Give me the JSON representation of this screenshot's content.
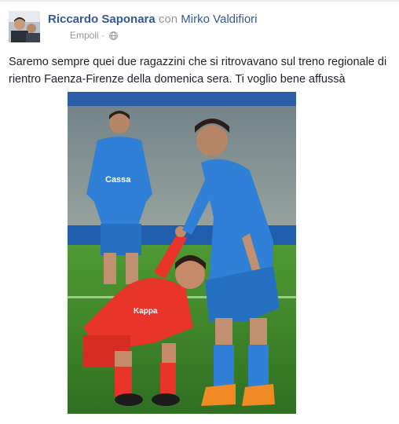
{
  "post": {
    "author": "Riccardo Saponara",
    "with_text": "con",
    "tagged": "Mirko Valdifiori",
    "location": "Empoli",
    "separator": "·",
    "audience_icon": "globe-icon",
    "text": "Saremo sempre quei due ragazzini che si ritrovavano sul treno regionale di rientro Faenza-Firenze della domenica sera. Ti voglio bene affussà"
  },
  "photo": {
    "jersey_blue_text": "Cassa",
    "sponsor_red_text": "Kappa"
  },
  "colors": {
    "link": "#365899",
    "meta": "#90949c",
    "text": "#1d2129",
    "pitch": "#3c7f2a",
    "blue_kit": "#2f80d6",
    "red_kit": "#e8342b"
  }
}
